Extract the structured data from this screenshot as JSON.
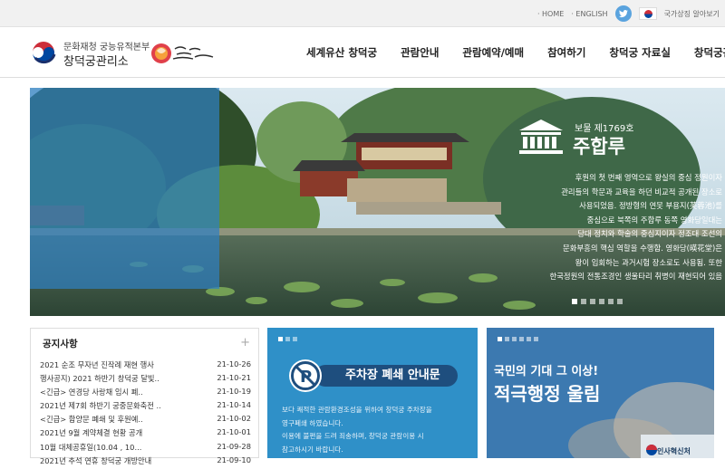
{
  "topbar": {
    "links": [
      "HOME",
      "ENGLISH"
    ],
    "national_symbol_label": "국가상징 알아보기"
  },
  "header": {
    "org": "문화재청 궁능유적본부",
    "name": "창덕궁관리소",
    "badge_text": "궁민의 마음 창덕궁 재생프로",
    "nav": [
      "세계유산 창덕궁",
      "관람안내",
      "관람예약/예매",
      "참여하기",
      "창덕궁 자료실",
      "창덕궁관리소"
    ]
  },
  "hero": {
    "subtitle": "보물 제1769호",
    "title": "주합루",
    "description": [
      "후원의 첫 번째 영역으로 왕실의 중심 정원이자",
      "관리들의 학문과 교육을 하던 비교적 공개된 장소로",
      "사용되었음. 정방형의 연못 부용지(芙蓉池)를",
      "중심으로 북쪽의 주합루 동쪽 영화당일대는",
      "당대 정치와 학술의 중심지이자 정조대 조선의",
      "문화부흥의 핵심 역할을 수행함. 영화당(暎花堂)은",
      "왕이 입회하는 과거시험 장소로도 사용됨. 또한",
      "한국정원의 전통조경인 생울타리 취병이 재현되어 있음"
    ],
    "slide_count": 6,
    "active_slide": 1
  },
  "notice": {
    "title": "공지사항",
    "more_label": "+",
    "items": [
      {
        "title": "2021 순조 무자년 진작례 재현 행사",
        "date": "21-10-26"
      },
      {
        "title": "행사공지) 2021 하반기 창덕궁 달빛..",
        "date": "21-10-21"
      },
      {
        "title": "<긴급> 연경당 사랑채 임시 폐..",
        "date": "21-10-19"
      },
      {
        "title": "2021년 제7회 하반기 궁중문화축전 ..",
        "date": "21-10-14"
      },
      {
        "title": "<긴급> 함양문 폐쇄 및 후원예..",
        "date": "21-10-02"
      },
      {
        "title": "2021년 9월 계약체결 현황 공개",
        "date": "21-10-01"
      },
      {
        "title": "10월 대체공휴일(10.04 , 10...",
        "date": "21-09-28"
      },
      {
        "title": "2021년 추석 연휴 창덕궁 개방안내",
        "date": "21-09-10"
      }
    ]
  },
  "parking": {
    "title": "주차장 폐쇄 안내문",
    "body": [
      "보다 쾌적한 관람환경조성을 위하여 창덕궁 주차장을",
      "영구폐쇄 하였습니다.",
      "이용에 불편을 드려 죄송하며, 창덕궁 관람이용 시",
      "참고하시기 바랍니다."
    ]
  },
  "admin_banner": {
    "line1": "국민의 기대 그 이상!",
    "line2": "적극행정 울림",
    "brand": "인사혁신처"
  },
  "colors": {
    "parking_bg": "#2f90c8",
    "admin_bg": "#3c79b0",
    "hero_panel": "#2f7fc0"
  }
}
